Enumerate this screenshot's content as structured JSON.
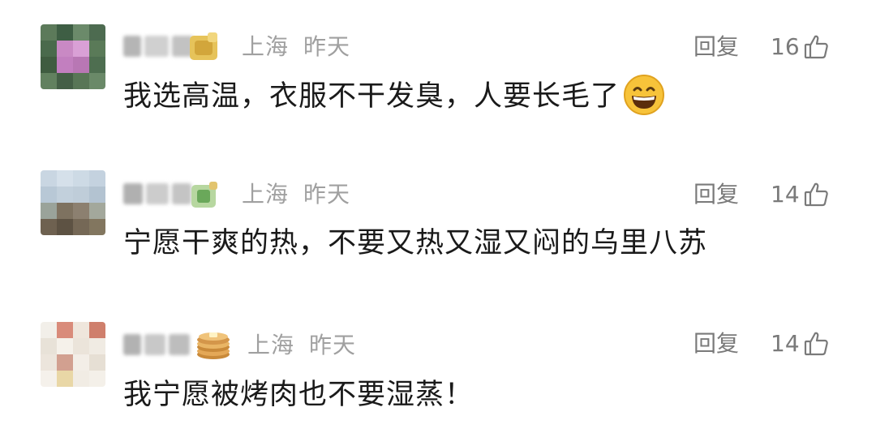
{
  "comments": [
    {
      "location": "上海",
      "time": "昨天",
      "reply_label": "回复",
      "likes": "16",
      "text": "我选高温，衣服不干发臭，人要长毛了",
      "text_emoji": "grinning-face-icon",
      "badge_icon": "yellow-cat-badge-icon"
    },
    {
      "location": "上海",
      "time": "昨天",
      "reply_label": "回复",
      "likes": "14",
      "text": "宁愿干爽的热，不要又热又湿又闷的乌里八苏",
      "badge_icon": "green-badge-icon"
    },
    {
      "location": "上海",
      "time": "昨天",
      "reply_label": "回复",
      "likes": "14",
      "text": "我宁愿被烤肉也不要湿蒸！",
      "badge_icon": "pancake-icon"
    }
  ]
}
